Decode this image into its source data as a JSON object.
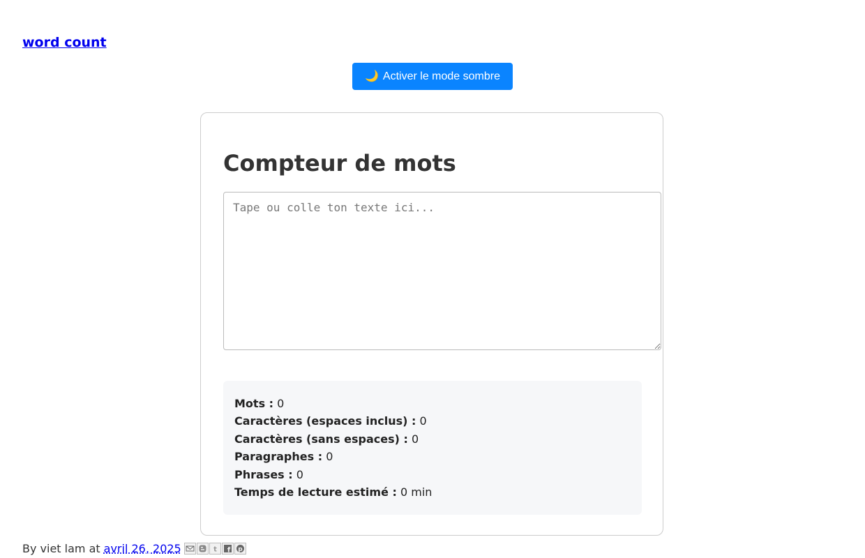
{
  "post": {
    "title": "word count"
  },
  "dark_mode_button": {
    "icon": "moon-icon",
    "label": "Activer le mode sombre"
  },
  "counter": {
    "title": "Compteur de mots",
    "placeholder": "Tape ou colle ton texte ici...",
    "value": ""
  },
  "stats": {
    "words": {
      "label": "Mots :",
      "value": "0"
    },
    "chars_with_spaces": {
      "label": "Caractères (espaces inclus) :",
      "value": "0"
    },
    "chars_no_spaces": {
      "label": "Caractères (sans espaces) :",
      "value": "0"
    },
    "paragraphs": {
      "label": "Paragraphes :",
      "value": "0"
    },
    "sentences": {
      "label": "Phrases :",
      "value": "0"
    },
    "reading_time": {
      "label": "Temps de lecture estimé :",
      "value": "0 min"
    }
  },
  "footer": {
    "by_prefix": "By viet lam at",
    "date": "avril 26, 2025",
    "share_icons": [
      "email-icon",
      "blogger-icon",
      "twitter-icon",
      "facebook-icon",
      "pinterest-icon"
    ]
  },
  "colors": {
    "button_bg": "#0a84ff",
    "link": "#0000ee",
    "stats_bg": "#f6f7f9"
  }
}
